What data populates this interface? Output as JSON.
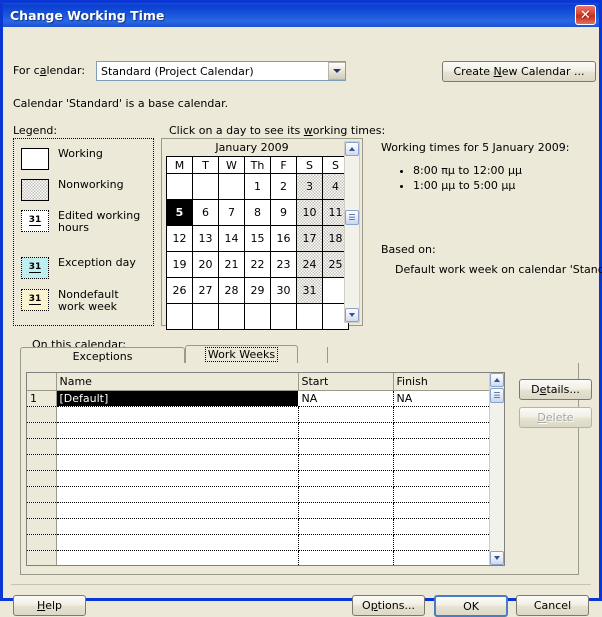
{
  "window": {
    "title": "Change Working Time",
    "close_icon": "close-icon"
  },
  "header": {
    "for_calendar_label": "For calendar:",
    "calendar_selected": "Standard (Project Calendar)",
    "create_new_calendar_label": "Create New Calendar ...",
    "base_calendar_note": "Calendar 'Standard' is a base calendar."
  },
  "legend": {
    "title": "Legend:",
    "on_this_calendar_label": "On this calendar:",
    "items": [
      {
        "label": "Working",
        "swatch": "working",
        "glyph": ""
      },
      {
        "label": "Nonworking",
        "swatch": "nonworking",
        "glyph": ""
      },
      {
        "label": "Edited working hours",
        "swatch": "edited",
        "glyph": "31"
      },
      {
        "label": "Exception day",
        "swatch": "exception",
        "glyph": "31"
      },
      {
        "label": "Nondefault work week",
        "swatch": "nondefault",
        "glyph": "31"
      }
    ],
    "colors": {
      "exception": "#bfeef0",
      "nondefault": "#fbf3cd",
      "nonworking": "#c4c2bb"
    }
  },
  "calendar": {
    "hint": "Click on a day to see its working times:",
    "month_title": "January 2009",
    "day_headers": [
      "M",
      "T",
      "W",
      "Th",
      "F",
      "S",
      "S"
    ],
    "weeks": [
      [
        {
          "d": "",
          "t": "empty"
        },
        {
          "d": "",
          "t": "empty"
        },
        {
          "d": "",
          "t": "empty"
        },
        {
          "d": "1",
          "t": "working"
        },
        {
          "d": "2",
          "t": "working"
        },
        {
          "d": "3",
          "t": "nonworking"
        },
        {
          "d": "4",
          "t": "nonworking"
        }
      ],
      [
        {
          "d": "5",
          "t": "selected"
        },
        {
          "d": "6",
          "t": "working"
        },
        {
          "d": "7",
          "t": "working"
        },
        {
          "d": "8",
          "t": "working"
        },
        {
          "d": "9",
          "t": "working"
        },
        {
          "d": "10",
          "t": "nonworking"
        },
        {
          "d": "11",
          "t": "nonworking"
        }
      ],
      [
        {
          "d": "12",
          "t": "working"
        },
        {
          "d": "13",
          "t": "working"
        },
        {
          "d": "14",
          "t": "working"
        },
        {
          "d": "15",
          "t": "working"
        },
        {
          "d": "16",
          "t": "working"
        },
        {
          "d": "17",
          "t": "nonworking"
        },
        {
          "d": "18",
          "t": "nonworking"
        }
      ],
      [
        {
          "d": "19",
          "t": "working"
        },
        {
          "d": "20",
          "t": "working"
        },
        {
          "d": "21",
          "t": "working"
        },
        {
          "d": "22",
          "t": "working"
        },
        {
          "d": "23",
          "t": "working"
        },
        {
          "d": "24",
          "t": "nonworking"
        },
        {
          "d": "25",
          "t": "nonworking"
        }
      ],
      [
        {
          "d": "26",
          "t": "working"
        },
        {
          "d": "27",
          "t": "working"
        },
        {
          "d": "28",
          "t": "working"
        },
        {
          "d": "29",
          "t": "working"
        },
        {
          "d": "30",
          "t": "working"
        },
        {
          "d": "31",
          "t": "nonworking"
        },
        {
          "d": "",
          "t": "empty"
        }
      ],
      [
        {
          "d": "",
          "t": "empty"
        },
        {
          "d": "",
          "t": "empty"
        },
        {
          "d": "",
          "t": "empty"
        },
        {
          "d": "",
          "t": "empty"
        },
        {
          "d": "",
          "t": "empty"
        },
        {
          "d": "",
          "t": "empty"
        },
        {
          "d": "",
          "t": "empty"
        }
      ]
    ],
    "selected_day": "5",
    "scrollbar": {
      "up_icon": "chevron-up-icon",
      "thumb_icon": "scrollbar-thumb",
      "down_icon": "chevron-down-icon"
    }
  },
  "working_times": {
    "heading": "Working times for 5 January 2009:",
    "entries": [
      "8:00 πμ to 12:00 μμ",
      "1:00 μμ to 5:00 μμ"
    ],
    "based_on_label": "Based on:",
    "based_on_value": "Default work week on calendar 'Standard'."
  },
  "tabs": [
    {
      "label": "Exceptions",
      "active": false
    },
    {
      "label": "Work Weeks",
      "active": true
    }
  ],
  "sheet": {
    "columns": [
      "",
      "Name",
      "Start",
      "Finish"
    ],
    "rows": [
      {
        "id": "1",
        "name": "[Default]",
        "start": "NA",
        "finish": "NA",
        "selected": true
      },
      {
        "id": "",
        "name": "",
        "start": "",
        "finish": "",
        "selected": false
      },
      {
        "id": "",
        "name": "",
        "start": "",
        "finish": "",
        "selected": false
      },
      {
        "id": "",
        "name": "",
        "start": "",
        "finish": "",
        "selected": false
      },
      {
        "id": "",
        "name": "",
        "start": "",
        "finish": "",
        "selected": false
      },
      {
        "id": "",
        "name": "",
        "start": "",
        "finish": "",
        "selected": false
      },
      {
        "id": "",
        "name": "",
        "start": "",
        "finish": "",
        "selected": false
      },
      {
        "id": "",
        "name": "",
        "start": "",
        "finish": "",
        "selected": false
      },
      {
        "id": "",
        "name": "",
        "start": "",
        "finish": "",
        "selected": false
      },
      {
        "id": "",
        "name": "",
        "start": "",
        "finish": "",
        "selected": false
      },
      {
        "id": "",
        "name": "",
        "start": "",
        "finish": "",
        "selected": false
      }
    ],
    "scrollbar": {
      "up_icon": "chevron-up-icon",
      "thumb_icon": "scrollbar-thumb",
      "down_icon": "chevron-down-icon"
    }
  },
  "side_buttons": {
    "details_label": "Details...",
    "delete_label": "Delete",
    "delete_disabled": true
  },
  "footer": {
    "help_label": "Help",
    "options_label": "Options...",
    "ok_label": "OK",
    "cancel_label": "Cancel"
  }
}
